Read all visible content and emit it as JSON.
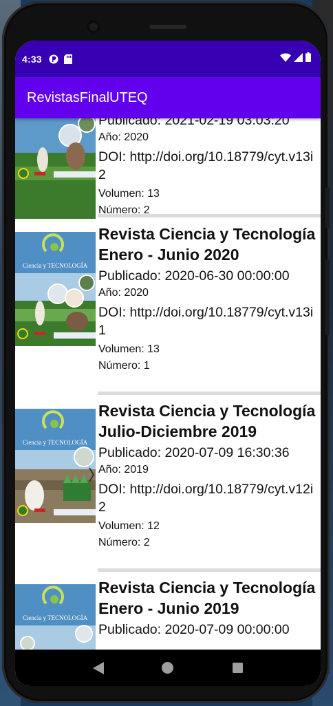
{
  "status_bar": {
    "time": "4:33"
  },
  "app_bar": {
    "title": "RevistasFinalUTEQ"
  },
  "cover": {
    "brand": "Ciencia y TECNOLOGÍA",
    "colors": {
      "sky": "#4f8fc4",
      "sky_light": "#a9cbe3",
      "field": "#3c7a2c",
      "bar": "#e8eef3"
    }
  },
  "items": [
    {
      "published": "Publicado: 2021-02-19 03:03:20",
      "year": "Año: 2020",
      "doi": "DOI: http://doi.org/10.18779/cyt.v13i2",
      "volume": "Volumen: 13",
      "number": "Número: 2"
    },
    {
      "title": "Revista Ciencia y Tecnología Enero - Junio 2020",
      "published": "Publicado: 2020-06-30 00:00:00",
      "year": "Año: 2020",
      "doi": "DOI: http://doi.org/10.18779/cyt.v13i1",
      "volume": "Volumen: 13",
      "number": "Número: 1"
    },
    {
      "title": "Revista Ciencia y Tecnología Julio-Diciembre 2019",
      "published": "Publicado: 2020-07-09 16:30:36",
      "year": "Año: 2019",
      "doi": "DOI: http://doi.org/10.18779/cyt.v12i2",
      "volume": "Volumen: 12",
      "number": "Número: 2"
    },
    {
      "title": "Revista Ciencia y Tecnología Enero - Junio 2019",
      "published": "Publicado: 2020-07-09 00:00:00"
    }
  ],
  "nav": {
    "back_icon": "back-triangle-icon",
    "home_icon": "home-circle-icon",
    "recents_icon": "recents-square-icon"
  }
}
